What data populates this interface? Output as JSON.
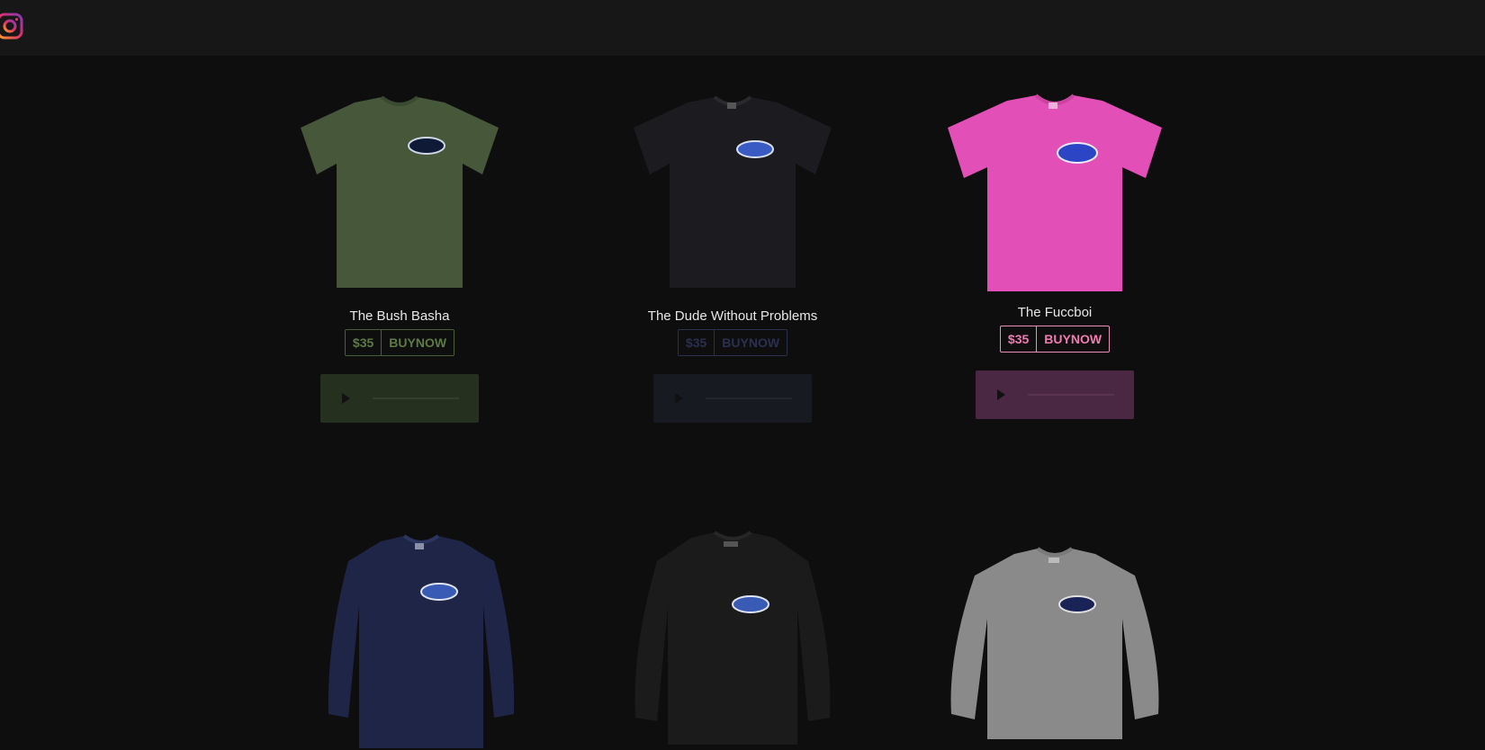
{
  "header": {
    "instagram_icon": "instagram-icon"
  },
  "products": [
    {
      "name": "The Bush Basha",
      "price": "$35",
      "buy_label": "BUYNOW",
      "color": "#4b5d3a",
      "accent": "#5d7a46"
    },
    {
      "name": "The Dude Without Problems",
      "price": "$35",
      "buy_label": "BUYNOW",
      "color": "#1c1c20",
      "accent": "#2b3050"
    },
    {
      "name": "The Fuccboi",
      "price": "$35",
      "buy_label": "BUYNOW",
      "color": "#e24fb6",
      "accent": "#f07bb0"
    },
    {
      "name": "",
      "color": "#1e2546"
    },
    {
      "name": "",
      "color": "#1b1b1c"
    },
    {
      "name": "",
      "color": "#8a8a8a"
    }
  ]
}
